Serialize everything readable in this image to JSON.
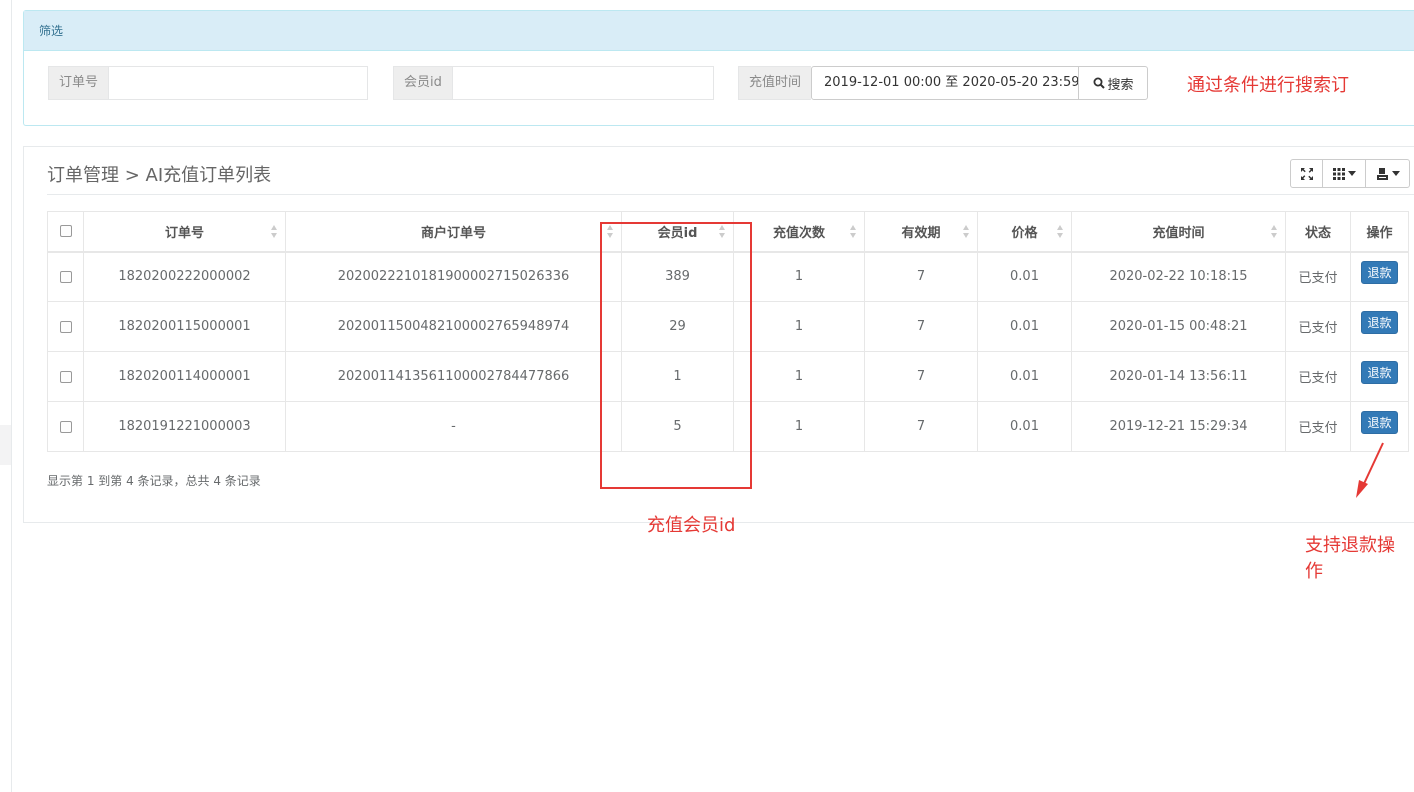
{
  "filter": {
    "title": "筛选",
    "order_no_label": "订单号",
    "order_no_value": "",
    "member_id_label": "会员id",
    "member_id_value": "",
    "time_label": "充值时间",
    "time_value": "2019-12-01 00:00 至 2020-05-20 23:59",
    "search_label": "搜索"
  },
  "panel": {
    "breadcrumb": "订单管理 > AI充值订单列表"
  },
  "table": {
    "headers": [
      "订单号",
      "商户订单号",
      "会员id",
      "充值次数",
      "有效期",
      "价格",
      "充值时间",
      "状态",
      "操作"
    ],
    "rows": [
      {
        "order_no": "1820200222000002",
        "merchant_no": "20200222101819000027150263 36",
        "member_id": "389",
        "count": "1",
        "validity": "7",
        "price": "0.01",
        "time": "2020-02-22 10:18:15",
        "status": "已支付",
        "action": "退款"
      },
      {
        "order_no": "1820200115000001",
        "merchant_no": "20200115004821000027659489 74",
        "member_id": "29",
        "count": "1",
        "validity": "7",
        "price": "0.01",
        "time": "2020-01-15 00:48:21",
        "status": "已支付",
        "action": "退款"
      },
      {
        "order_no": "1820200114000001",
        "merchant_no": "20200114135611000027844778 66",
        "member_id": "1",
        "count": "1",
        "validity": "7",
        "price": "0.01",
        "time": "2020-01-14 13:56:11",
        "status": "已支付",
        "action": "退款"
      },
      {
        "order_no": "1820191221000003",
        "merchant_no": "-",
        "member_id": "5",
        "count": "1",
        "validity": "7",
        "price": "0.01",
        "time": "2019-12-21 15:29:34",
        "status": "已支付",
        "action": "退款"
      }
    ]
  },
  "pagination": {
    "summary": "显示第 1 到第 4 条记录，总共 4 条记录"
  },
  "annotations": {
    "search_note": "通过条件进行搜索订",
    "member_note": "充值会员id",
    "refund_note": "支持退款操作"
  },
  "colors": {
    "filter_header_bg": "#d9edf7",
    "refund_button": "#337ab7",
    "annotation_red": "#e53935"
  }
}
